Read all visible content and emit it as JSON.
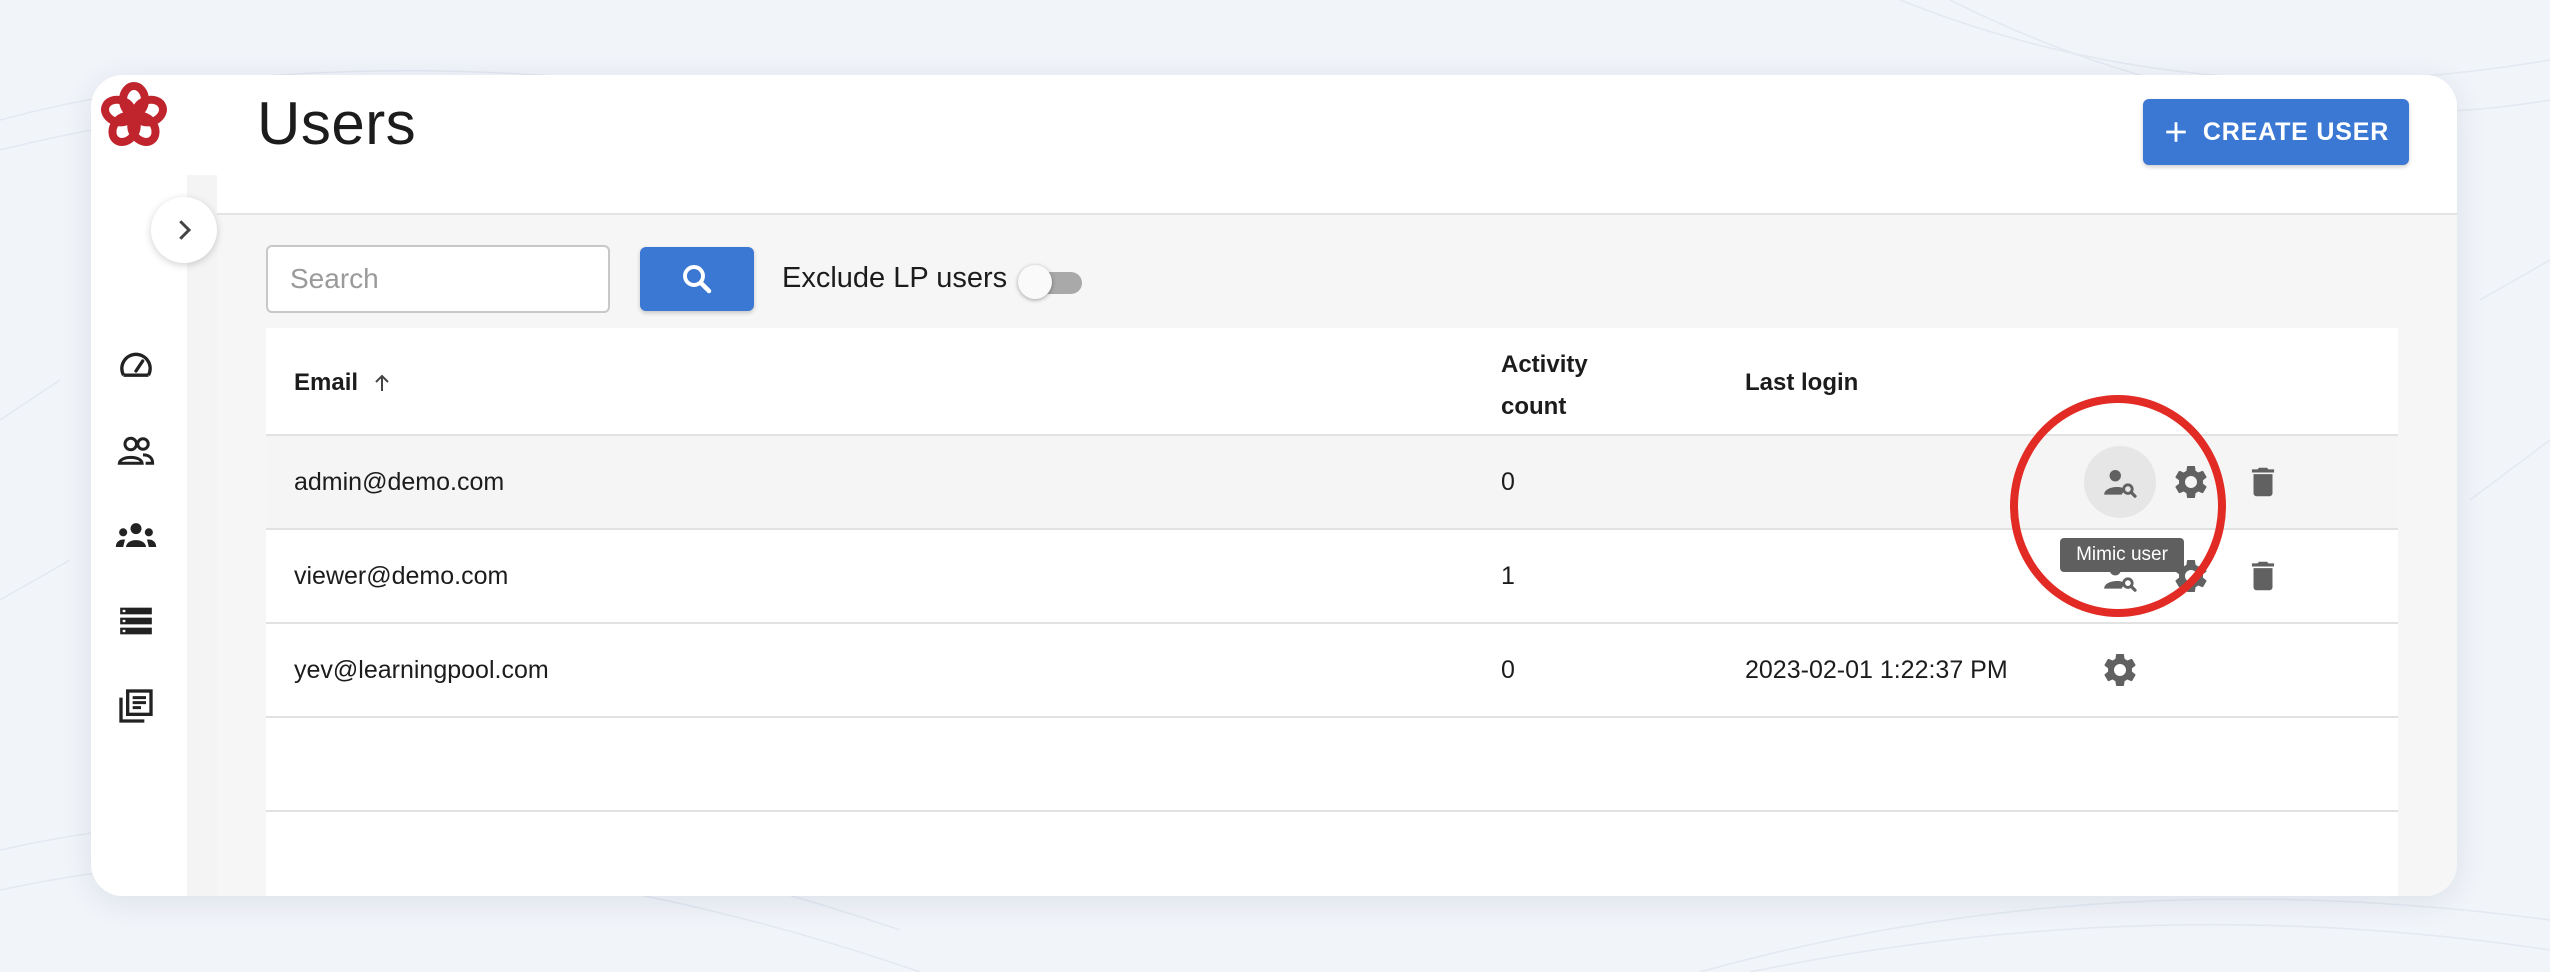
{
  "page": {
    "title": "Users"
  },
  "header": {
    "create_button_label": "CREATE USER"
  },
  "filters": {
    "search_placeholder": "Search",
    "search_value": "",
    "exclude_label": "Exclude LP users",
    "exclude_enabled": false
  },
  "table": {
    "columns": {
      "email": "Email",
      "activity_line1": "Activity",
      "activity_line2": "count",
      "last_login": "Last login"
    },
    "sort": {
      "column": "Email",
      "direction": "ascending"
    },
    "rows": [
      {
        "email": "admin@demo.com",
        "activity": "0",
        "last_login": "",
        "actions": [
          "mimic",
          "settings",
          "delete"
        ]
      },
      {
        "email": "viewer@demo.com",
        "activity": "1",
        "last_login": "",
        "actions": [
          "mimic",
          "settings",
          "delete"
        ]
      },
      {
        "email": "yev@learningpool.com",
        "activity": "0",
        "last_login": "2023-02-01 1:22:37 PM",
        "actions": [
          "settings"
        ]
      }
    ]
  },
  "tooltip": {
    "text": "Mimic user"
  },
  "sidebar": {
    "items": [
      {
        "icon": "dashboard-gauge-icon"
      },
      {
        "icon": "users-icon"
      },
      {
        "icon": "groups-icon"
      },
      {
        "icon": "list-icon"
      },
      {
        "icon": "library-icon"
      }
    ]
  },
  "colors": {
    "accent": "#3a78d4",
    "logo": "#c0252d",
    "highlight_circle": "#e22b24"
  }
}
